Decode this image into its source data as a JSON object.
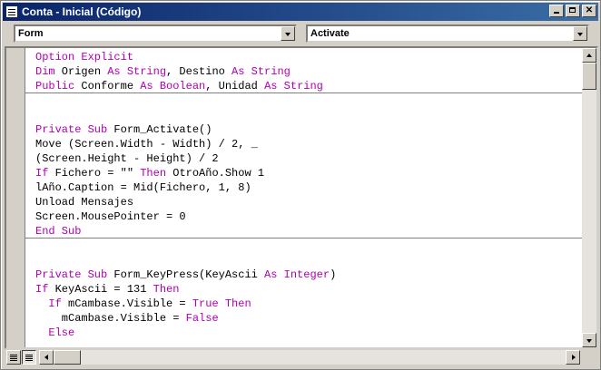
{
  "window": {
    "title": "Conta - Inicial (Código)"
  },
  "combos": {
    "object": {
      "value": "Form"
    },
    "procedure": {
      "value": "Activate"
    }
  },
  "colors": {
    "keyword": "#b000b0",
    "titlebar": "#0a246a"
  },
  "code_lines": [
    [
      {
        "t": "Option Explicit",
        "k": true
      }
    ],
    [
      {
        "t": "Dim",
        "k": true
      },
      {
        "t": " Origen "
      },
      {
        "t": "As String",
        "k": true
      },
      {
        "t": ", Destino "
      },
      {
        "t": "As String",
        "k": true
      }
    ],
    [
      {
        "t": "Public",
        "k": true
      },
      {
        "t": " Conforme "
      },
      {
        "t": "As Boolean",
        "k": true
      },
      {
        "t": ", Unidad "
      },
      {
        "t": "As String",
        "k": true
      }
    ],
    [
      {
        "t": ""
      }
    ],
    [
      {
        "t": ""
      }
    ],
    [
      {
        "t": "Private Sub",
        "k": true
      },
      {
        "t": " Form_Activate()"
      }
    ],
    [
      {
        "t": "Move (Screen.Width - Width) / 2, _"
      }
    ],
    [
      {
        "t": "(Screen.Height - Height) / 2"
      }
    ],
    [
      {
        "t": "If",
        "k": true
      },
      {
        "t": " Fichero = \"\" "
      },
      {
        "t": "Then",
        "k": true
      },
      {
        "t": " OtroAño.Show 1"
      }
    ],
    [
      {
        "t": "lAño.Caption = Mid(Fichero, 1, 8)"
      }
    ],
    [
      {
        "t": "Unload Mensajes"
      }
    ],
    [
      {
        "t": "Screen.MousePointer = 0"
      }
    ],
    [
      {
        "t": "End Sub",
        "k": true
      }
    ],
    [
      {
        "t": ""
      }
    ],
    [
      {
        "t": ""
      }
    ],
    [
      {
        "t": "Private Sub",
        "k": true
      },
      {
        "t": " Form_KeyPress(KeyAscii "
      },
      {
        "t": "As Integer",
        "k": true
      },
      {
        "t": ")"
      }
    ],
    [
      {
        "t": "If",
        "k": true
      },
      {
        "t": " KeyAscii = 131 "
      },
      {
        "t": "Then",
        "k": true
      }
    ],
    [
      {
        "t": "  "
      },
      {
        "t": "If",
        "k": true
      },
      {
        "t": " mCambase.Visible = "
      },
      {
        "t": "True Then",
        "k": true
      }
    ],
    [
      {
        "t": "    mCambase.Visible = "
      },
      {
        "t": "False",
        "k": true
      }
    ],
    [
      {
        "t": "  "
      },
      {
        "t": "Else",
        "k": true
      }
    ]
  ]
}
